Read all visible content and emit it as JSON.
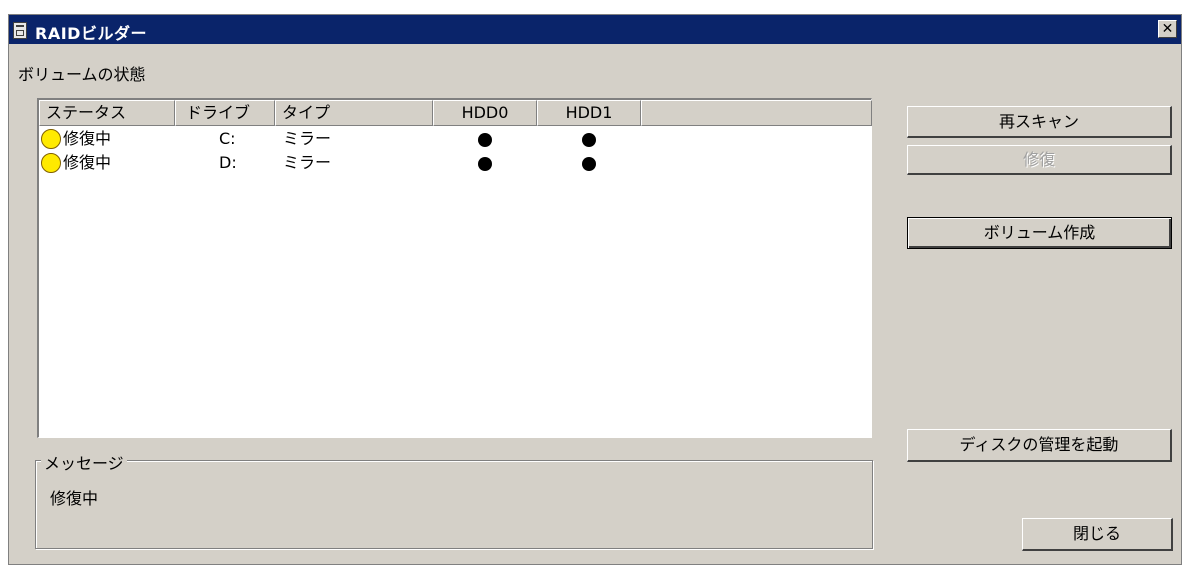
{
  "window": {
    "title": "RAIDビルダー",
    "close_glyph": "✕"
  },
  "volumes": {
    "section_label": "ボリュームの状態",
    "columns": [
      "ステータス",
      "ドライブ",
      "タイプ",
      "HDD0",
      "HDD1"
    ],
    "rows": [
      {
        "status": "修復中",
        "status_color": "#ffea00",
        "drive": "C:",
        "type": "ミラー"
      },
      {
        "status": "修復中",
        "status_color": "#ffea00",
        "drive": "D:",
        "type": "ミラー"
      }
    ]
  },
  "message": {
    "legend": "メッセージ",
    "text": "修復中"
  },
  "buttons": {
    "rescan": "再スキャン",
    "repair": "修復",
    "create_volume": "ボリューム作成",
    "disk_management": "ディスクの管理を起動",
    "close": "閉じる"
  },
  "icons": {
    "app": "raid-builder-icon",
    "close": "close-icon",
    "status": "yellow-circle-icon",
    "hdd_member": "black-dot-icon"
  }
}
